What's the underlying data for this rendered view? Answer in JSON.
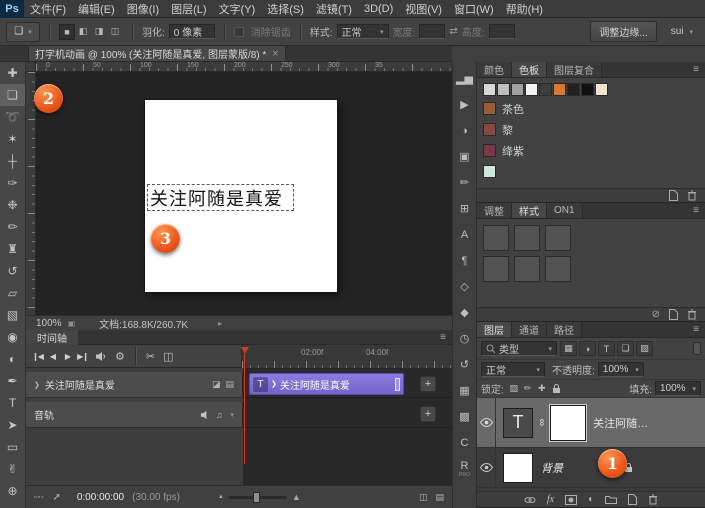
{
  "glyphs": {
    "caret": "▾",
    "menu": "≡",
    "chevron": "❯",
    "plus": "+",
    "note": "♫",
    "gear": "⚙",
    "scissors": "✂",
    "transition": "◫",
    "dots": "▫▫▫",
    "arrow_up_right": "➚",
    "tri_small": "▲",
    "tri_big": "▲",
    "swap": "⇄",
    "mask_link": "∞",
    "status_arrow": "▸",
    "adjust_half": "◐"
  },
  "colors": {
    "clip_purple": "#7a6cd4",
    "badge_orange": "#ea5418",
    "playhead_red": "#d2392b"
  },
  "menubar": {
    "logo": "Ps",
    "items": [
      "文件(F)",
      "编辑(E)",
      "图像(I)",
      "图层(L)",
      "文字(Y)",
      "选择(S)",
      "滤镜(T)",
      "3D(D)",
      "视图(V)",
      "窗口(W)",
      "帮助(H)"
    ]
  },
  "options": {
    "tool_icon": "❏",
    "modes": [
      {
        "name": "new-selection",
        "glyph": "■"
      },
      {
        "name": "add-to-selection",
        "glyph": "◧"
      },
      {
        "name": "subtract-from-selection",
        "glyph": "◨"
      },
      {
        "name": "intersect-selection",
        "glyph": "◫"
      }
    ],
    "feather_label": "羽化:",
    "feather_value": "0 像素",
    "antialias": "消除锯齿",
    "style_label": "样式:",
    "style_value": "正常",
    "width_label": "宽度:",
    "height_label": "高度:",
    "refine_edge": "调整边缘...",
    "workspace": "sui"
  },
  "doc_tab": {
    "title": "打字机动画 @ 100% (关注阿随是真爱, 图层蒙版/8) *",
    "close": "×"
  },
  "tools": [
    {
      "name": "move",
      "glyph": "✚"
    },
    {
      "name": "rectangular-marquee",
      "glyph": "❏",
      "selected": true
    },
    {
      "name": "lasso",
      "glyph": "➰"
    },
    {
      "name": "quick-selection",
      "glyph": "✶"
    },
    {
      "name": "crop",
      "glyph": "┼"
    },
    {
      "name": "eyedropper",
      "glyph": "✑"
    },
    {
      "name": "healing-brush",
      "glyph": "❉"
    },
    {
      "name": "brush",
      "glyph": "✏"
    },
    {
      "name": "clone-stamp",
      "glyph": "♜"
    },
    {
      "name": "history-brush",
      "glyph": "↺"
    },
    {
      "name": "eraser",
      "glyph": "▱"
    },
    {
      "name": "gradient",
      "glyph": "▧"
    },
    {
      "name": "blur",
      "glyph": "◉"
    },
    {
      "name": "dodge",
      "glyph": "◐"
    },
    {
      "name": "pen",
      "glyph": "✒"
    },
    {
      "name": "type",
      "glyph": "T"
    },
    {
      "name": "path-selection",
      "glyph": "➤"
    },
    {
      "name": "shape",
      "glyph": "▭"
    },
    {
      "name": "hand",
      "glyph": "✌"
    },
    {
      "name": "zoom",
      "glyph": "⊕"
    }
  ],
  "ruler_numbers": [
    "0",
    "50",
    "100",
    "150",
    "200",
    "250",
    "300",
    "35"
  ],
  "canvas": {
    "text": "关注阿随是真爱"
  },
  "badges": {
    "one": "1",
    "two": "2",
    "three": "3"
  },
  "statusbar": {
    "zoom": "100%",
    "doc_info": "文档:168.8K/260.7K"
  },
  "timeline": {
    "tab": "时间轴",
    "transport": [
      {
        "name": "go-to-first-frame",
        "glyph": "❙◀"
      },
      {
        "name": "previous-frame",
        "glyph": "◀"
      },
      {
        "name": "play",
        "glyph": "▶"
      },
      {
        "name": "next-frame",
        "glyph": "▶❙"
      }
    ],
    "times": [
      "02:00f",
      "04:00f"
    ],
    "video_track": {
      "name": "关注阿随是真爱",
      "clip_icon": "T",
      "clip_label": "关注阿随是真爱",
      "icons": [
        {
          "name": "track-filmstrip",
          "glyph": "◪"
        },
        {
          "name": "track-options",
          "glyph": "▤"
        }
      ]
    },
    "audio_track": {
      "name": "音轨"
    },
    "current_time": "0:00:00:00",
    "fps": "(30.00 fps)",
    "bottom_right_icons": [
      {
        "name": "timeline-transition",
        "glyph": "◫"
      },
      {
        "name": "timeline-render",
        "glyph": "▤"
      }
    ]
  },
  "side_icons": [
    {
      "name": "histogram-panel",
      "glyph": "▂▅"
    },
    {
      "name": "actions-panel",
      "glyph": "▶"
    },
    {
      "name": "adjustments-panel",
      "glyph": "◑"
    },
    {
      "name": "properties-panel",
      "glyph": "▣"
    },
    {
      "name": "brush-panel",
      "glyph": "✏"
    },
    {
      "name": "clone-source-panel",
      "glyph": "⊞"
    },
    {
      "name": "character-panel",
      "glyph": "A"
    },
    {
      "name": "paragraph-panel",
      "glyph": "¶"
    },
    {
      "name": "3d-panel",
      "glyph": "◇"
    },
    {
      "name": "materials-panel",
      "glyph": "◆"
    },
    {
      "name": "timeline-panel",
      "glyph": "◷"
    },
    {
      "name": "history-panel",
      "glyph": "↺"
    },
    {
      "name": "navigator-panel",
      "glyph": "▦"
    },
    {
      "name": "info-panel",
      "glyph": "▩"
    },
    {
      "name": "extension-c-panel",
      "glyph": "C"
    },
    {
      "name": "on1-resize-panel",
      "glyph": "R",
      "sub": "PRO"
    }
  ],
  "swatches_panel": {
    "tabs": [
      "颜色",
      "色板",
      "图层复合"
    ],
    "mini": [
      "#d8d8d8",
      "#bdbdbd",
      "#9fa0a0",
      "#f4f4f4",
      "#3d3d3d",
      "#e0762b",
      "#23201d",
      "#101010",
      "#efe6cb"
    ],
    "named": [
      {
        "name": "茶色",
        "color": "#9c5a36"
      },
      {
        "name": "黎",
        "color": "#8a4740"
      },
      {
        "name": "绛紫",
        "color": "#7b3746"
      },
      {
        "name": "",
        "color": "#cfe9d8"
      }
    ]
  },
  "styles_panel": {
    "tabs": [
      "调整",
      "样式",
      "ON1"
    ],
    "thumbs": [
      "#525252",
      "#525252",
      "#525252",
      "#525252",
      "#525252",
      "#525252"
    ],
    "clear_glyph": "⊘"
  },
  "layers_panel": {
    "tabs": [
      "图层",
      "通道",
      "路径"
    ],
    "filter_label": "类型",
    "filter_icons": [
      {
        "name": "filter-pixel-layers",
        "glyph": "▦"
      },
      {
        "name": "filter-adjustment-layers",
        "glyph": "◑"
      },
      {
        "name": "filter-type-layers",
        "glyph": "T"
      },
      {
        "name": "filter-shape-layers",
        "glyph": "❏"
      },
      {
        "name": "filter-smart-objects",
        "glyph": "▨"
      }
    ],
    "blend_mode": "正常",
    "opacity_label": "不透明度:",
    "opacity_value": "100%",
    "lock_label": "锁定:",
    "lock_icons": [
      {
        "name": "lock-transparent-pixels",
        "glyph": "▨"
      },
      {
        "name": "lock-image-pixels",
        "glyph": "✏"
      },
      {
        "name": "lock-position",
        "glyph": "✚"
      }
    ],
    "fill_label": "填充:",
    "fill_value": "100%",
    "fx_label": "fx",
    "layers": [
      {
        "thumb_glyph": "T",
        "name": "关注阿随…"
      },
      {
        "name": "背景"
      }
    ]
  }
}
